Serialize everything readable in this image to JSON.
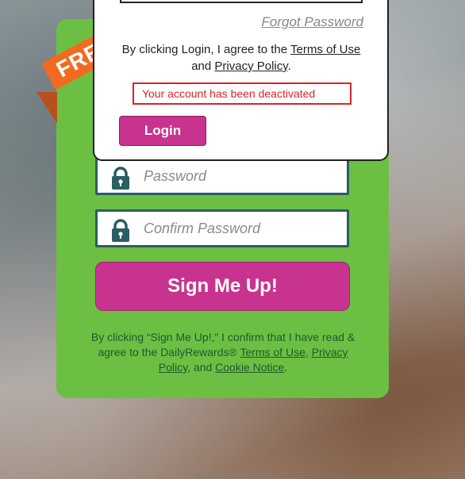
{
  "ribbon": {
    "text": "FREE"
  },
  "signup": {
    "password_placeholder": "Password",
    "confirm_password_placeholder": "Confirm Password",
    "submit_label": "Sign Me Up!",
    "consent_prefix": "By clicking “Sign Me Up!,” I confirm that I have read & agree to the DailyRewards® ",
    "terms_link": "Terms of Use",
    "sep1": ", ",
    "privacy_link": "Privacy Policy",
    "sep2": ", and ",
    "cookie_link": "Cookie Notice",
    "suffix": "."
  },
  "login_modal": {
    "forgot_password": "Forgot Password",
    "agree_prefix": "By clicking Login, I agree to the ",
    "terms_link": "Terms of Use",
    "agree_mid": " and ",
    "privacy_link": "Privacy Policy",
    "agree_suffix": ".",
    "error_message": "Your account has been deactivated",
    "login_label": "Login"
  },
  "colors": {
    "card_green": "#6cbf43",
    "accent_magenta": "#c8338f",
    "field_border": "#2a5e63",
    "ribbon_orange": "#f26a21",
    "error_red": "#dd2222"
  },
  "icons": {
    "field_icon": "lock-icon"
  }
}
